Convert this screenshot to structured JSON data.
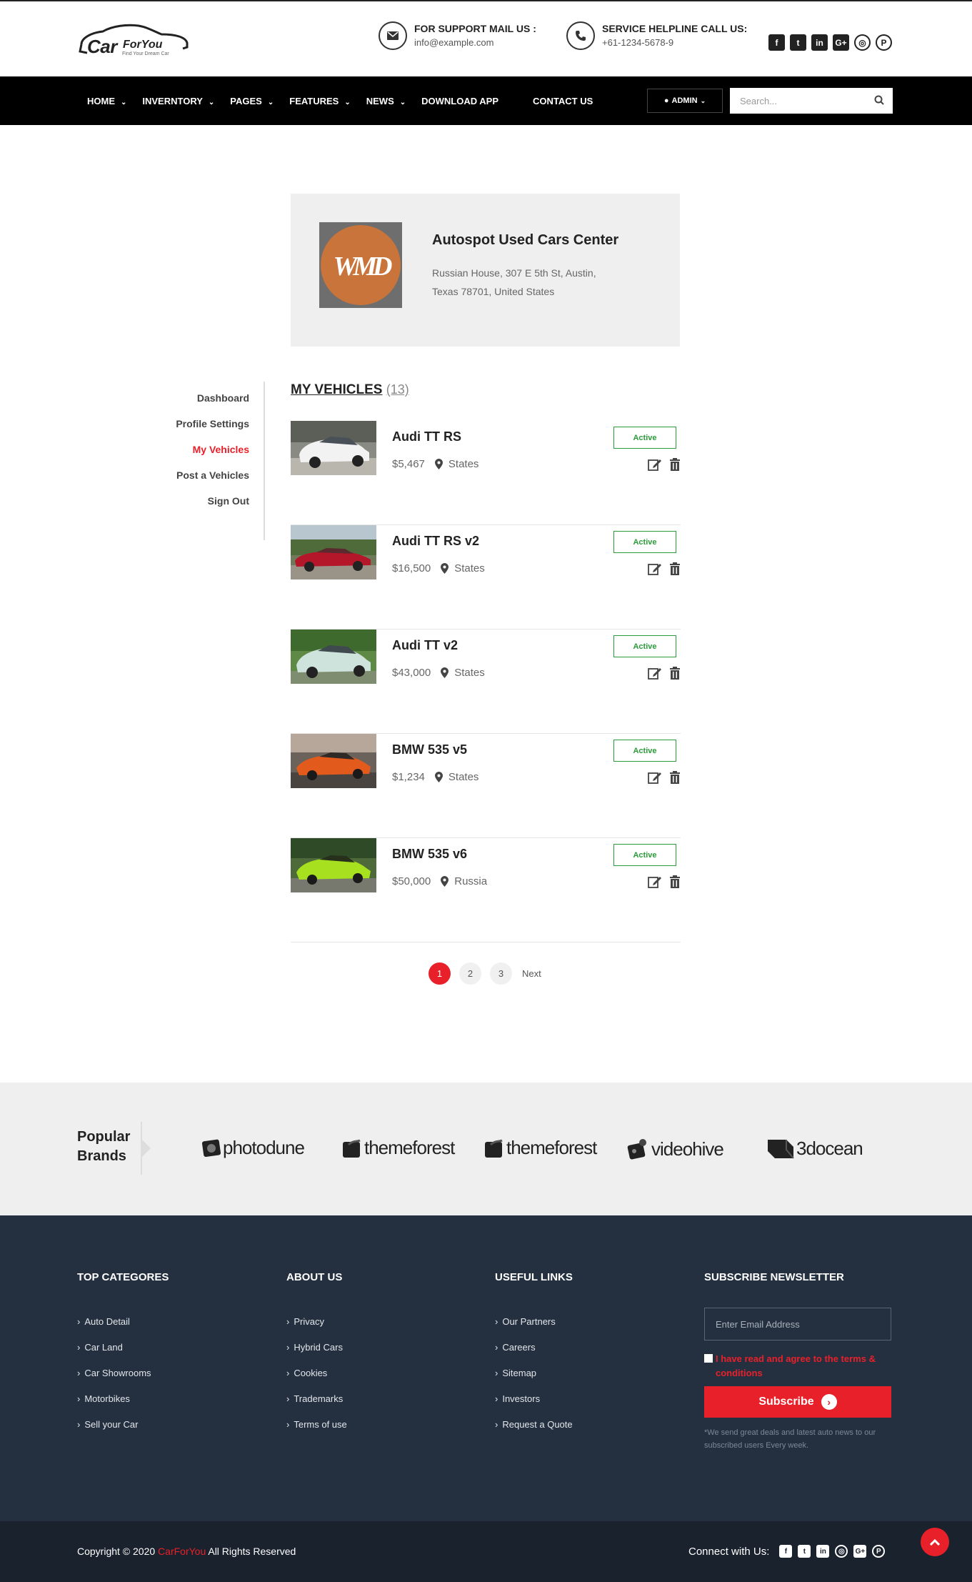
{
  "header": {
    "logo": {
      "main": "Car",
      "sub": "ForYou",
      "tagline": "Find Your Dream Car"
    },
    "support": {
      "label": "FOR SUPPORT MAIL US :",
      "value": "info@example.com"
    },
    "helpline": {
      "label": "SERVICE HELPLINE CALL US:",
      "value": "+61-1234-5678-9"
    },
    "social": [
      "facebook-icon",
      "twitter-icon",
      "linkedin-icon",
      "google-plus-icon",
      "instagram-icon",
      "pinterest-icon"
    ]
  },
  "nav": {
    "items": [
      {
        "label": "HOME"
      },
      {
        "label": "INVERNTORY"
      },
      {
        "label": "PAGES"
      },
      {
        "label": "FEATURES"
      },
      {
        "label": "NEWS"
      },
      {
        "label": "DOWNLOAD APP"
      },
      {
        "label": "CONTACT US"
      }
    ],
    "admin": "ADMIN",
    "search_placeholder": "Search..."
  },
  "dealer": {
    "logo_text": "WMD",
    "name": "Autospot Used Cars Center",
    "address_line1": "Russian House, 307 E 5th St, Austin,",
    "address_line2": "Texas 78701, United States"
  },
  "sidebar": {
    "items": [
      {
        "label": "Dashboard"
      },
      {
        "label": "Profile Settings"
      },
      {
        "label": "My Vehicles"
      },
      {
        "label": "Post a Vehicles"
      },
      {
        "label": "Sign Out"
      }
    ]
  },
  "vehicles": {
    "heading": "MY VEHICLES",
    "count": "(13)",
    "items": [
      {
        "title": "Audi TT RS",
        "price": "$5,467",
        "location": "States",
        "status": "Active"
      },
      {
        "title": "Audi TT RS v2",
        "price": "$16,500",
        "location": "States",
        "status": "Active"
      },
      {
        "title": "Audi TT v2",
        "price": "$43,000",
        "location": "States",
        "status": "Active"
      },
      {
        "title": "BMW 535 v5",
        "price": "$1,234",
        "location": "States",
        "status": "Active"
      },
      {
        "title": "BMW 535 v6",
        "price": "$50,000",
        "location": "Russia",
        "status": "Active"
      }
    ]
  },
  "pagination": {
    "pages": [
      "1",
      "2",
      "3"
    ],
    "current": "1",
    "next": "Next"
  },
  "brands": {
    "title_line1": "Popular",
    "title_line2": "Brands",
    "items": [
      "photodune",
      "themeforest",
      "themeforest",
      "videohive",
      "3docean"
    ]
  },
  "footer": {
    "categories": {
      "title": "TOP CATEGORES",
      "items": [
        "Auto Detail",
        "Car Land",
        "Car Showrooms",
        "Motorbikes",
        "Sell your Car"
      ]
    },
    "about": {
      "title": "ABOUT US",
      "items": [
        "Privacy",
        "Hybrid Cars",
        "Cookies",
        "Trademarks",
        "Terms of use"
      ]
    },
    "useful": {
      "title": "USEFUL LINKS",
      "items": [
        "Our Partners",
        "Careers",
        "Sitemap",
        "Investors",
        "Request a Quote"
      ]
    },
    "newsletter": {
      "title": "SUBSCRIBE NEWSLETTER",
      "placeholder": "Enter Email Address",
      "agree_text": "I have read and agree to the terms & conditions",
      "button": "Subscribe",
      "note": "*We send great deals and latest auto news to our subscribed users Every week."
    },
    "copyright_prefix": "Copyright © 2020",
    "copyright_brand": "CarForYou",
    "copyright_suffix": "All Rights Reserved",
    "connect": "Connect with Us:"
  },
  "colors": {
    "accent": "#e8202a",
    "active_badge": "#2a9d3a",
    "footer_bg": "#243040",
    "nav_bg": "#000000"
  }
}
